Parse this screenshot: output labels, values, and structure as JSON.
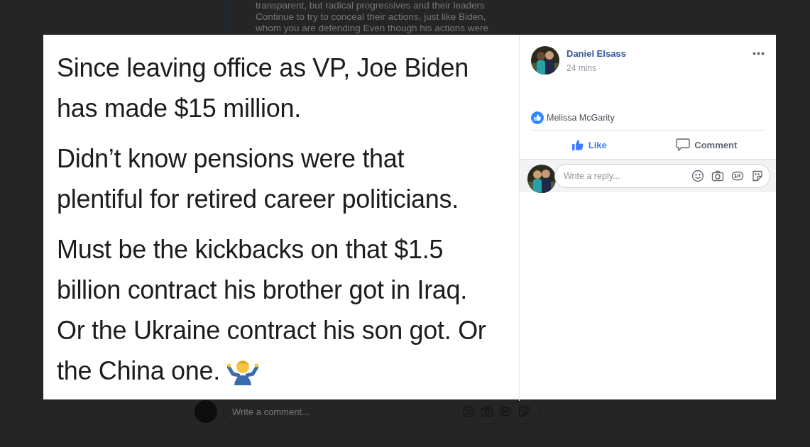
{
  "background_post": {
    "text_lines": [
      "transparent, but radical progressives and their leaders",
      "Continue to try to conceal their actions, just like Biden,",
      "whom you are defending Even though his actions were"
    ],
    "comment_box": {
      "placeholder": "Write a comment..."
    }
  },
  "photo": {
    "paragraphs": [
      [
        "Since leaving office as VP, Joe Biden",
        "has made $15 million."
      ],
      [
        "Didn’t know pensions were that",
        "plentiful for retired career politicians."
      ],
      [
        "Must be the kickbacks on that $1.5",
        "billion contract his brother got in Iraq.",
        "Or the Ukraine contract his son got. Or",
        "the China one."
      ]
    ]
  },
  "post": {
    "author": "Daniel Elsass",
    "time": "24 mins"
  },
  "reactions": {
    "names": "Melissa McGarity"
  },
  "actions": [
    {
      "label": "Like",
      "selected": true
    },
    {
      "label": "Comment",
      "selected": false
    }
  ],
  "reply_box": {
    "placeholder": "Write a reply..."
  }
}
